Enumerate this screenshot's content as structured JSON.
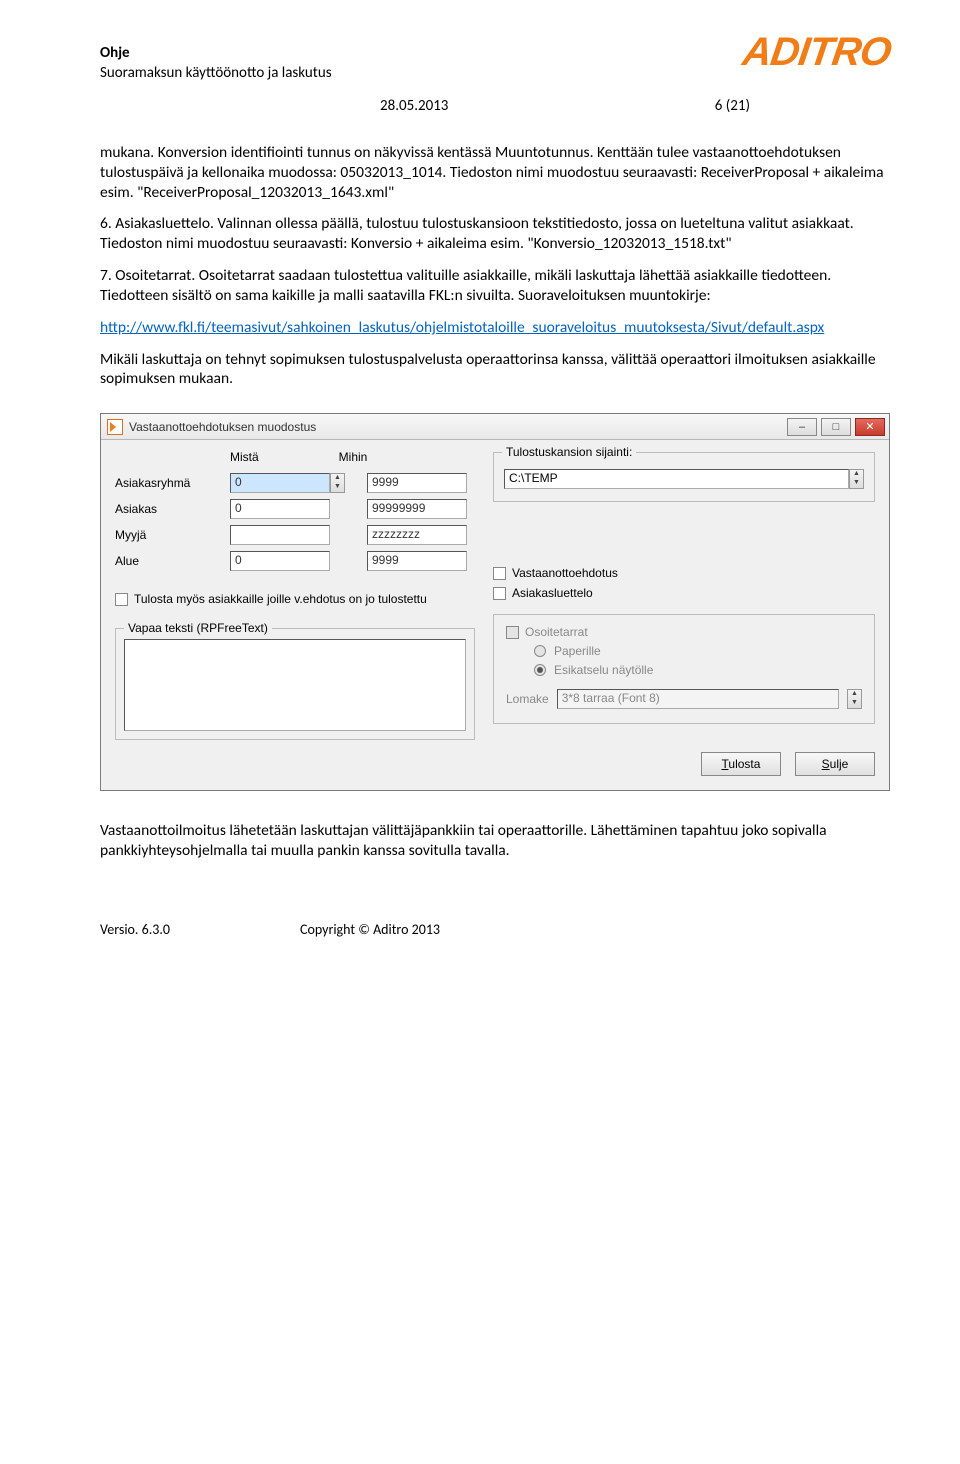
{
  "header": {
    "title": "Ohje",
    "subtitle": "Suoramaksun käyttöönotto ja laskutus",
    "logo": "ADITRO",
    "date": "28.05.2013",
    "page": "6 (21)"
  },
  "body": {
    "p1": "mukana. Konversion identifiointi tunnus on näkyvissä kentässä Muuntotunnus. Kenttään tulee vastaanottoehdotuksen tulostuspäivä ja kellonaika muodossa: 05032013_1014. Tiedoston nimi muodostuu seuraavasti: ReceiverProposal + aikaleima esim. \"ReceiverProposal_12032013_1643.xml\"",
    "p2": "6. Asiakasluettelo. Valinnan ollessa päällä, tulostuu tulostuskansioon tekstitiedosto, jossa on lueteltuna valitut asiakkaat. Tiedoston nimi muodostuu seuraavasti: Konversio + aikaleima esim. \"Konversio_12032013_1518.txt\"",
    "p3": "7. Osoitetarrat. Osoitetarrat saadaan tulostettua valituille asiakkaille, mikäli laskuttaja lähettää asiakkaille tiedotteen. Tiedotteen sisältö on sama kaikille ja malli saatavilla FKL:n sivuilta. Suoraveloituksen muuntokirje:",
    "link": "http://www.fkl.fi/teemasivut/sahkoinen_laskutus/ohjelmistotaloille_suoraveloitus_muutoksesta/Sivut/default.aspx",
    "p4": "Mikäli laskuttaja on tehnyt sopimuksen tulostuspalvelusta operaattorinsa kanssa, välittää operaattori ilmoituksen asiakkaille sopimuksen mukaan.",
    "p5": "Vastaanottoilmoitus lähetetään laskuttajan välittäjäpankkiin tai operaattorille. Lähettäminen tapahtuu joko sopivalla pankkiyhteysohjelmalla tai muulla pankin kanssa sovitulla tavalla."
  },
  "window": {
    "title": "Vastaanottoehdotuksen muodostus",
    "col_from": "Mistä",
    "col_to": "Mihin",
    "rows": {
      "asiakasryhma": {
        "label": "Asiakasryhmä",
        "from": "0",
        "to": "9999"
      },
      "asiakas": {
        "label": "Asiakas",
        "from": "0",
        "to": "99999999"
      },
      "myyja": {
        "label": "Myyjä",
        "from": "",
        "to": "zzzzzzzz"
      },
      "alue": {
        "label": "Alue",
        "from": "0",
        "to": "9999"
      }
    },
    "check_printed": "Tulosta myös asiakkaille joille v.ehdotus on jo tulostettu",
    "freetext_label": "Vapaa teksti (RPFreeText)",
    "folder_label": "Tulostuskansion sijainti:",
    "folder_value": "C:\\TEMP",
    "opt_proposal": "Vastaanottoehdotus",
    "opt_customerlist": "Asiakasluettelo",
    "opt_labels": "Osoitetarrat",
    "radio_paper": "Paperille",
    "radio_preview": "Esikatselu näytölle",
    "lomake_label": "Lomake",
    "lomake_value": "3*8 tarraa (Font 8)",
    "btn_print": "Tulosta",
    "btn_close": "Sulje"
  },
  "footer": {
    "version": "Versio. 6.3.0",
    "copyright": "Copyright © Aditro 2013"
  }
}
